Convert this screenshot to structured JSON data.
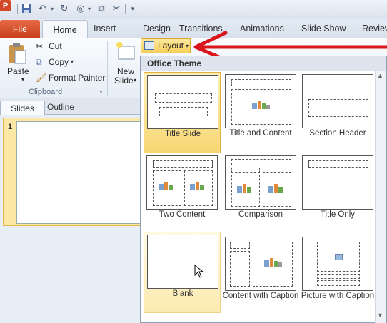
{
  "qat": {
    "app_letter": "P"
  },
  "tabs": {
    "file": "File",
    "home": "Home",
    "insert": "Insert",
    "design": "Design",
    "transitions": "Transitions",
    "animations": "Animations",
    "slideshow": "Slide Show",
    "review": "Review"
  },
  "ribbon": {
    "paste": "Paste",
    "cut": "Cut",
    "copy": "Copy",
    "format_painter": "Format Painter",
    "new_slide_1": "New",
    "new_slide_2": "Slide",
    "clipboard_group": "Clipboard",
    "layout": "Layout"
  },
  "pane": {
    "slides_tab": "Slides",
    "outline_tab": "Outline",
    "slide_number": "1"
  },
  "gallery": {
    "title": "Office Theme",
    "layouts": [
      {
        "label": "Title Slide",
        "selected": true
      },
      {
        "label": "Title and Content"
      },
      {
        "label": "Section Header"
      },
      {
        "label": "Two Content"
      },
      {
        "label": "Comparison"
      },
      {
        "label": "Title Only"
      },
      {
        "label": "Blank",
        "hovered": true
      },
      {
        "label": "Content with Caption"
      },
      {
        "label": "Picture with Caption"
      }
    ]
  },
  "colors": {
    "accent_file": "#d24726",
    "highlight": "#f7cf5a",
    "arrow": "#d8161c"
  }
}
